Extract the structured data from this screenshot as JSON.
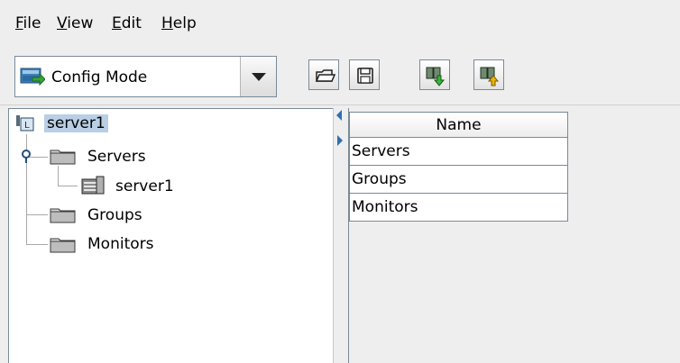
{
  "menu": {
    "items": [
      {
        "mnemonic": "F",
        "rest": "ile"
      },
      {
        "mnemonic": "V",
        "rest": "iew"
      },
      {
        "mnemonic": "E",
        "rest": "dit"
      },
      {
        "mnemonic": "H",
        "rest": "elp"
      }
    ]
  },
  "toolbar": {
    "mode_select": {
      "selected": "Config Mode",
      "icon": "config-mode-icon"
    },
    "buttons": [
      {
        "icon": "open-folder-icon"
      },
      {
        "icon": "save-floppy-icon"
      },
      {
        "icon": "download-config-icon"
      },
      {
        "icon": "upload-config-icon"
      }
    ]
  },
  "tree": {
    "root": {
      "label": "server1",
      "icon": "cluster-root-icon"
    },
    "nodes": [
      {
        "label": "Servers",
        "icon": "folder-icon"
      },
      {
        "label": "server1",
        "icon": "server-icon"
      },
      {
        "label": "Groups",
        "icon": "folder-icon"
      },
      {
        "label": "Monitors",
        "icon": "folder-icon"
      }
    ]
  },
  "table": {
    "columns": [
      "Name"
    ],
    "rows": [
      "Servers",
      "Groups",
      "Monitors"
    ]
  },
  "colors": {
    "selection": "#b8cfe5",
    "background": "#eeeeee",
    "border": "#7a8a99"
  }
}
